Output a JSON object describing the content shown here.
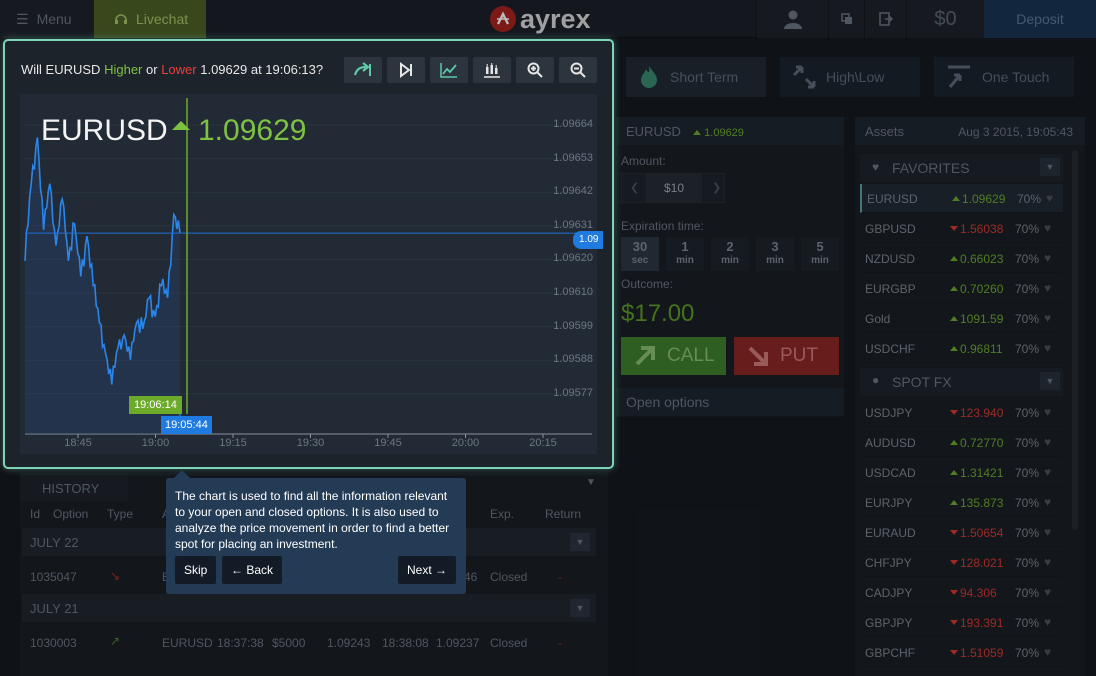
{
  "topbar": {
    "menu_label": "Menu",
    "livechat_label": "Livechat",
    "logo_text": "ayrex",
    "balance": "$0",
    "deposit_label": "Deposit"
  },
  "chart": {
    "question_prefix": "Will EURUSD",
    "higher": "Higher",
    "or": "or",
    "lower": "Lower",
    "question_suffix": "1.09629 at 19:06:13?",
    "pair": "EURUSD",
    "price": "1.09629",
    "y_labels": [
      "1.09664",
      "1.09653",
      "1.09642",
      "1.09631",
      "1.09620",
      "1.09610",
      "1.09599",
      "1.09588",
      "1.09577"
    ],
    "x_labels": [
      "18:45",
      "19:00",
      "19:15",
      "19:30",
      "19:45",
      "20:00",
      "20:15"
    ],
    "expiry_tag": "19:06:14",
    "now_tag": "19:05:44",
    "price_tag": "1.09"
  },
  "chart_data": {
    "type": "line",
    "title": "EURUSD",
    "x": [
      "18:41",
      "18:42",
      "18:43",
      "18:44",
      "18:45",
      "18:46",
      "18:47",
      "18:48",
      "18:49",
      "18:50",
      "18:51",
      "18:52",
      "18:53",
      "18:54",
      "18:55",
      "18:56",
      "18:57",
      "18:58",
      "18:59",
      "19:00",
      "19:01",
      "19:02",
      "19:03",
      "19:04",
      "19:05",
      "19:05:44"
    ],
    "values": [
      1.0962,
      1.09645,
      1.0966,
      1.0963,
      1.09645,
      1.09625,
      1.0964,
      1.0962,
      1.09632,
      1.09615,
      1.09628,
      1.09612,
      1.096,
      1.0959,
      1.0958,
      1.09592,
      1.09596,
      1.09588,
      1.096,
      1.09598,
      1.09608,
      1.09602,
      1.09612,
      1.09608,
      1.09635,
      1.09629
    ],
    "ylim": [
      1.0957,
      1.0967
    ],
    "grid": true
  },
  "history": {
    "tab": "HISTORY",
    "columns": [
      "Id",
      "Option",
      "Type",
      "A",
      "Exp.",
      "Return"
    ],
    "groups": [
      {
        "date": "JULY 22",
        "row": {
          "id": "1035047",
          "asset": "E",
          "exp_price": "46",
          "status": "Closed",
          "return": "-"
        }
      },
      {
        "date": "JULY 21",
        "row": {
          "id": "1030003",
          "asset": "EURUSD",
          "time": "18:37:38",
          "amount": "$5000",
          "price": "1.09243",
          "exp_time": "18:38:08",
          "exp_price": "1.09237",
          "status": "Closed",
          "return": "-"
        }
      }
    ]
  },
  "tooltip": {
    "text": "The chart is used to find all the information relevant to your open and closed options. It is also used to analyze the price movement in order to find a better spot for placing an investment.",
    "skip": "Skip",
    "back": "← Back",
    "next": "Next →"
  },
  "modes": [
    "Short Term",
    "High\\Low",
    "One Touch"
  ],
  "trade": {
    "pair": "EURUSD",
    "price": "1.09629",
    "amount_label": "Amount:",
    "amount": "$10",
    "expiration_label": "Expiration time:",
    "expirations": [
      {
        "value": "30",
        "unit": "sec"
      },
      {
        "value": "1",
        "unit": "min"
      },
      {
        "value": "2",
        "unit": "min"
      },
      {
        "value": "3",
        "unit": "min"
      },
      {
        "value": "5",
        "unit": "min"
      }
    ],
    "outcome_label": "Outcome:",
    "outcome": "$17.00",
    "call": "CALL",
    "put": "PUT",
    "open_options": "Open options"
  },
  "assets": {
    "title": "Assets",
    "date": "Aug 3 2015, 19:05:43",
    "favorites_label": "FAVORITES",
    "spot_label": "SPOT FX",
    "favorites": [
      {
        "name": "EURUSD",
        "price": "1.09629",
        "dir": "up",
        "pct": "70%"
      },
      {
        "name": "GBPUSD",
        "price": "1.56038",
        "dir": "down",
        "pct": "70%"
      },
      {
        "name": "NZDUSD",
        "price": "0.66023",
        "dir": "up",
        "pct": "70%"
      },
      {
        "name": "EURGBP",
        "price": "0.70260",
        "dir": "up",
        "pct": "70%"
      },
      {
        "name": "Gold",
        "price": "1091.59",
        "dir": "up",
        "pct": "70%"
      },
      {
        "name": "USDCHF",
        "price": "0.96811",
        "dir": "up",
        "pct": "70%"
      }
    ],
    "spot": [
      {
        "name": "USDJPY",
        "price": "123.940",
        "dir": "down",
        "pct": "70%"
      },
      {
        "name": "AUDUSD",
        "price": "0.72770",
        "dir": "up",
        "pct": "70%"
      },
      {
        "name": "USDCAD",
        "price": "1.31421",
        "dir": "up",
        "pct": "70%"
      },
      {
        "name": "EURJPY",
        "price": "135.873",
        "dir": "up",
        "pct": "70%"
      },
      {
        "name": "EURAUD",
        "price": "1.50654",
        "dir": "down",
        "pct": "70%"
      },
      {
        "name": "CHFJPY",
        "price": "128.021",
        "dir": "down",
        "pct": "70%"
      },
      {
        "name": "CADJPY",
        "price": "94.306",
        "dir": "down",
        "pct": "70%"
      },
      {
        "name": "GBPJPY",
        "price": "193.391",
        "dir": "down",
        "pct": "70%"
      },
      {
        "name": "GBPCHF",
        "price": "1.51059",
        "dir": "down",
        "pct": "70%"
      }
    ],
    "up_color": "#6caa2a",
    "down_color": "#d8352f"
  }
}
